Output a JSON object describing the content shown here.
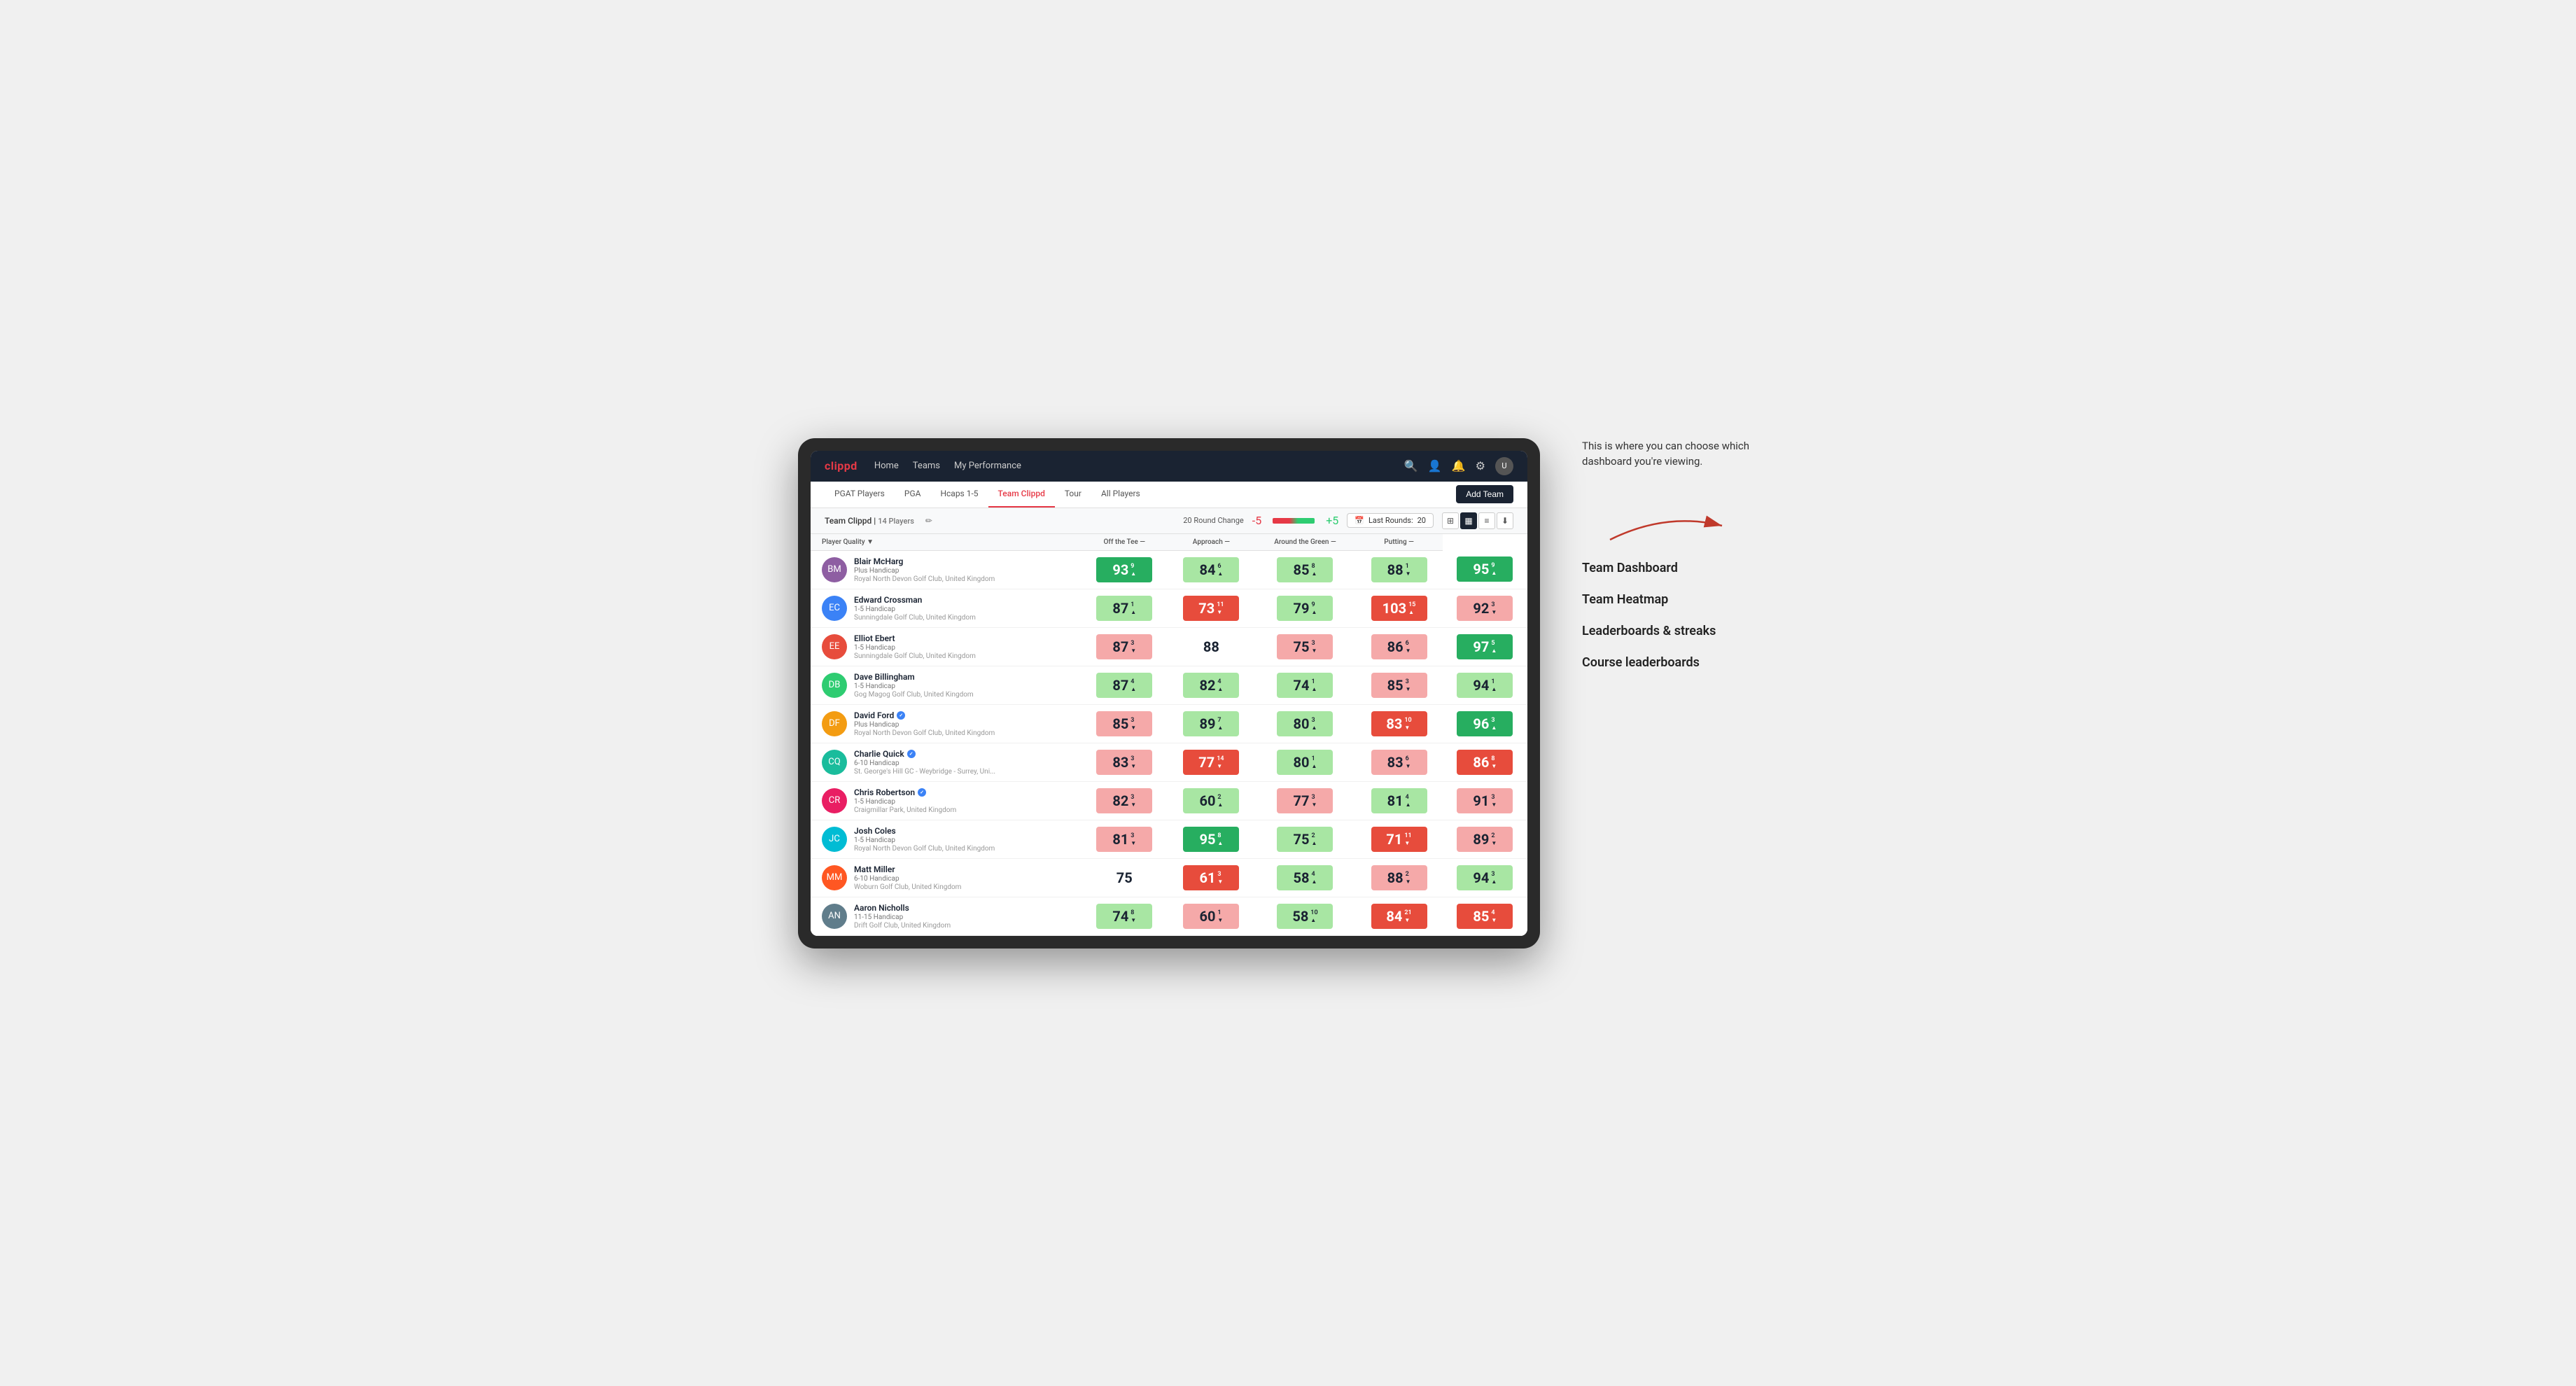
{
  "annotation": {
    "intro_text": "This is where you can choose which dashboard you're viewing.",
    "options": [
      {
        "label": "Team Dashboard"
      },
      {
        "label": "Team Heatmap"
      },
      {
        "label": "Leaderboards & streaks"
      },
      {
        "label": "Course leaderboards"
      }
    ]
  },
  "nav": {
    "logo": "clippd",
    "links": [
      {
        "label": "Home",
        "active": false
      },
      {
        "label": "Teams",
        "active": false
      },
      {
        "label": "My Performance",
        "active": false
      }
    ],
    "icons": [
      "search",
      "person",
      "bell",
      "settings",
      "avatar"
    ]
  },
  "sub_nav": {
    "links": [
      {
        "label": "PGAT Players",
        "active": false
      },
      {
        "label": "PGA",
        "active": false
      },
      {
        "label": "Hcaps 1-5",
        "active": false
      },
      {
        "label": "Team Clippd",
        "active": true
      },
      {
        "label": "Tour",
        "active": false
      },
      {
        "label": "All Players",
        "active": false
      }
    ],
    "add_team_label": "Add Team"
  },
  "team_header": {
    "team_name": "Team Clippd",
    "separator": "|",
    "player_count": "14 Players",
    "round_change_label": "20 Round Change",
    "change_neg": "-5",
    "change_pos": "+5",
    "last_rounds_label": "Last Rounds:",
    "last_rounds_value": "20"
  },
  "table": {
    "columns": {
      "player": "Player Quality ▼",
      "off_tee": "Off the Tee —",
      "approach": "Approach —",
      "around_green": "Around the Green —",
      "putting": "Putting —"
    },
    "rows": [
      {
        "name": "Blair McHarg",
        "handicap": "Plus Handicap",
        "club": "Royal North Devon Golf Club, United Kingdom",
        "verified": false,
        "scores": {
          "quality": {
            "value": 93,
            "change": "9",
            "dir": "up",
            "color": "green-dark"
          },
          "off_tee": {
            "value": 84,
            "change": "6",
            "dir": "up",
            "color": "green-light"
          },
          "approach": {
            "value": 85,
            "change": "8",
            "dir": "up",
            "color": "green-light"
          },
          "around_green": {
            "value": 88,
            "change": "1",
            "dir": "down",
            "color": "green-light"
          },
          "putting": {
            "value": 95,
            "change": "9",
            "dir": "up",
            "color": "green-dark"
          }
        }
      },
      {
        "name": "Edward Crossman",
        "handicap": "1-5 Handicap",
        "club": "Sunningdale Golf Club, United Kingdom",
        "verified": false,
        "scores": {
          "quality": {
            "value": 87,
            "change": "1",
            "dir": "up",
            "color": "green-light"
          },
          "off_tee": {
            "value": 73,
            "change": "11",
            "dir": "down",
            "color": "red-dark"
          },
          "approach": {
            "value": 79,
            "change": "9",
            "dir": "up",
            "color": "green-light"
          },
          "around_green": {
            "value": 103,
            "change": "15",
            "dir": "up",
            "color": "red-dark"
          },
          "putting": {
            "value": 92,
            "change": "3",
            "dir": "down",
            "color": "red-light"
          }
        }
      },
      {
        "name": "Elliot Ebert",
        "handicap": "1-5 Handicap",
        "club": "Sunningdale Golf Club, United Kingdom",
        "verified": false,
        "scores": {
          "quality": {
            "value": 87,
            "change": "3",
            "dir": "down",
            "color": "red-light"
          },
          "off_tee": {
            "value": 88,
            "change": "",
            "dir": "",
            "color": "white"
          },
          "approach": {
            "value": 75,
            "change": "3",
            "dir": "down",
            "color": "red-light"
          },
          "around_green": {
            "value": 86,
            "change": "6",
            "dir": "down",
            "color": "red-light"
          },
          "putting": {
            "value": 97,
            "change": "5",
            "dir": "up",
            "color": "green-dark"
          }
        }
      },
      {
        "name": "Dave Billingham",
        "handicap": "1-5 Handicap",
        "club": "Gog Magog Golf Club, United Kingdom",
        "verified": false,
        "scores": {
          "quality": {
            "value": 87,
            "change": "4",
            "dir": "up",
            "color": "green-light"
          },
          "off_tee": {
            "value": 82,
            "change": "4",
            "dir": "up",
            "color": "green-light"
          },
          "approach": {
            "value": 74,
            "change": "1",
            "dir": "up",
            "color": "green-light"
          },
          "around_green": {
            "value": 85,
            "change": "3",
            "dir": "down",
            "color": "red-light"
          },
          "putting": {
            "value": 94,
            "change": "1",
            "dir": "up",
            "color": "green-light"
          }
        }
      },
      {
        "name": "David Ford",
        "handicap": "Plus Handicap",
        "club": "Royal North Devon Golf Club, United Kingdom",
        "verified": true,
        "scores": {
          "quality": {
            "value": 85,
            "change": "3",
            "dir": "down",
            "color": "red-light"
          },
          "off_tee": {
            "value": 89,
            "change": "7",
            "dir": "up",
            "color": "green-light"
          },
          "approach": {
            "value": 80,
            "change": "3",
            "dir": "up",
            "color": "green-light"
          },
          "around_green": {
            "value": 83,
            "change": "10",
            "dir": "down",
            "color": "red-dark"
          },
          "putting": {
            "value": 96,
            "change": "3",
            "dir": "up",
            "color": "green-dark"
          }
        }
      },
      {
        "name": "Charlie Quick",
        "handicap": "6-10 Handicap",
        "club": "St. George's Hill GC - Weybridge - Surrey, Uni...",
        "verified": true,
        "scores": {
          "quality": {
            "value": 83,
            "change": "3",
            "dir": "down",
            "color": "red-light"
          },
          "off_tee": {
            "value": 77,
            "change": "14",
            "dir": "down",
            "color": "red-dark"
          },
          "approach": {
            "value": 80,
            "change": "1",
            "dir": "up",
            "color": "green-light"
          },
          "around_green": {
            "value": 83,
            "change": "6",
            "dir": "down",
            "color": "red-light"
          },
          "putting": {
            "value": 86,
            "change": "8",
            "dir": "down",
            "color": "red-dark"
          }
        }
      },
      {
        "name": "Chris Robertson",
        "handicap": "1-5 Handicap",
        "club": "Craigmillar Park, United Kingdom",
        "verified": true,
        "scores": {
          "quality": {
            "value": 82,
            "change": "3",
            "dir": "down",
            "color": "red-light"
          },
          "off_tee": {
            "value": 60,
            "change": "2",
            "dir": "up",
            "color": "green-light"
          },
          "approach": {
            "value": 77,
            "change": "3",
            "dir": "down",
            "color": "red-light"
          },
          "around_green": {
            "value": 81,
            "change": "4",
            "dir": "up",
            "color": "green-light"
          },
          "putting": {
            "value": 91,
            "change": "3",
            "dir": "down",
            "color": "red-light"
          }
        }
      },
      {
        "name": "Josh Coles",
        "handicap": "1-5 Handicap",
        "club": "Royal North Devon Golf Club, United Kingdom",
        "verified": false,
        "scores": {
          "quality": {
            "value": 81,
            "change": "3",
            "dir": "down",
            "color": "red-light"
          },
          "off_tee": {
            "value": 95,
            "change": "8",
            "dir": "up",
            "color": "green-dark"
          },
          "approach": {
            "value": 75,
            "change": "2",
            "dir": "up",
            "color": "green-light"
          },
          "around_green": {
            "value": 71,
            "change": "11",
            "dir": "down",
            "color": "red-dark"
          },
          "putting": {
            "value": 89,
            "change": "2",
            "dir": "down",
            "color": "red-light"
          }
        }
      },
      {
        "name": "Matt Miller",
        "handicap": "6-10 Handicap",
        "club": "Woburn Golf Club, United Kingdom",
        "verified": false,
        "scores": {
          "quality": {
            "value": 75,
            "change": "",
            "dir": "",
            "color": "white"
          },
          "off_tee": {
            "value": 61,
            "change": "3",
            "dir": "down",
            "color": "red-dark"
          },
          "approach": {
            "value": 58,
            "change": "4",
            "dir": "up",
            "color": "green-light"
          },
          "around_green": {
            "value": 88,
            "change": "2",
            "dir": "down",
            "color": "red-light"
          },
          "putting": {
            "value": 94,
            "change": "3",
            "dir": "up",
            "color": "green-light"
          }
        }
      },
      {
        "name": "Aaron Nicholls",
        "handicap": "11-15 Handicap",
        "club": "Drift Golf Club, United Kingdom",
        "verified": false,
        "scores": {
          "quality": {
            "value": 74,
            "change": "8",
            "dir": "down",
            "color": "green-light"
          },
          "off_tee": {
            "value": 60,
            "change": "1",
            "dir": "down",
            "color": "red-light"
          },
          "approach": {
            "value": 58,
            "change": "10",
            "dir": "up",
            "color": "green-light"
          },
          "around_green": {
            "value": 84,
            "change": "21",
            "dir": "down",
            "color": "red-dark"
          },
          "putting": {
            "value": 85,
            "change": "4",
            "dir": "down",
            "color": "red-dark"
          }
        }
      }
    ]
  }
}
